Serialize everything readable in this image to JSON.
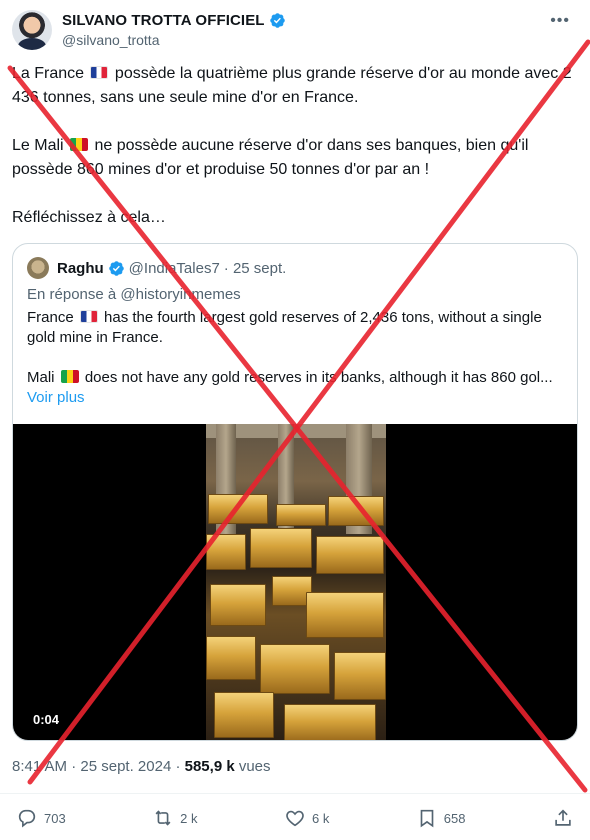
{
  "author": {
    "display_name": "SILVANO TROTTA OFFICIEL",
    "handle": "@silvano_trotta",
    "more_icon": "more-horizontal-icon"
  },
  "post": {
    "paragraph1_before_flag": "La France ",
    "paragraph1_after_flag": " possède la quatrième plus grande réserve d'or au monde avec 2 436 tonnes, sans une seule mine d'or en France.",
    "paragraph2_before_flag": "Le Mali ",
    "paragraph2_after_flag": " ne possède aucune réserve d'or dans ses banques, bien qu'il possède 860 mines d'or et produise 50 tonnes d'or par an !",
    "paragraph3": "Réfléchissez à cela…"
  },
  "quote": {
    "display_name": "Raghu",
    "handle": "@IndiaTales7",
    "date": "· 25 sept.",
    "reply_to": "En réponse à @historyinmemes",
    "text1_before_flag": "France ",
    "text1_after_flag": " has the fourth largest gold reserves of 2,436 tons, without a single gold mine in France.",
    "text2_before_flag": "Mali ",
    "text2_after_flag": " does not have any gold reserves in its banks, although it has 860 gol...",
    "show_more": "Voir plus",
    "video_timestamp": "0:04"
  },
  "meta": {
    "time": "8:41 AM",
    "date": "· 25 sept. 2024 ·",
    "views_count": "585,9 k",
    "views_label": "vues"
  },
  "actions": {
    "replies": "703",
    "reposts": "2 k",
    "likes": "6 k",
    "bookmarks": "658"
  },
  "colors": {
    "accent": "#1d9bf0",
    "cross_red": "#e8222d",
    "secondary_text": "#536471"
  }
}
